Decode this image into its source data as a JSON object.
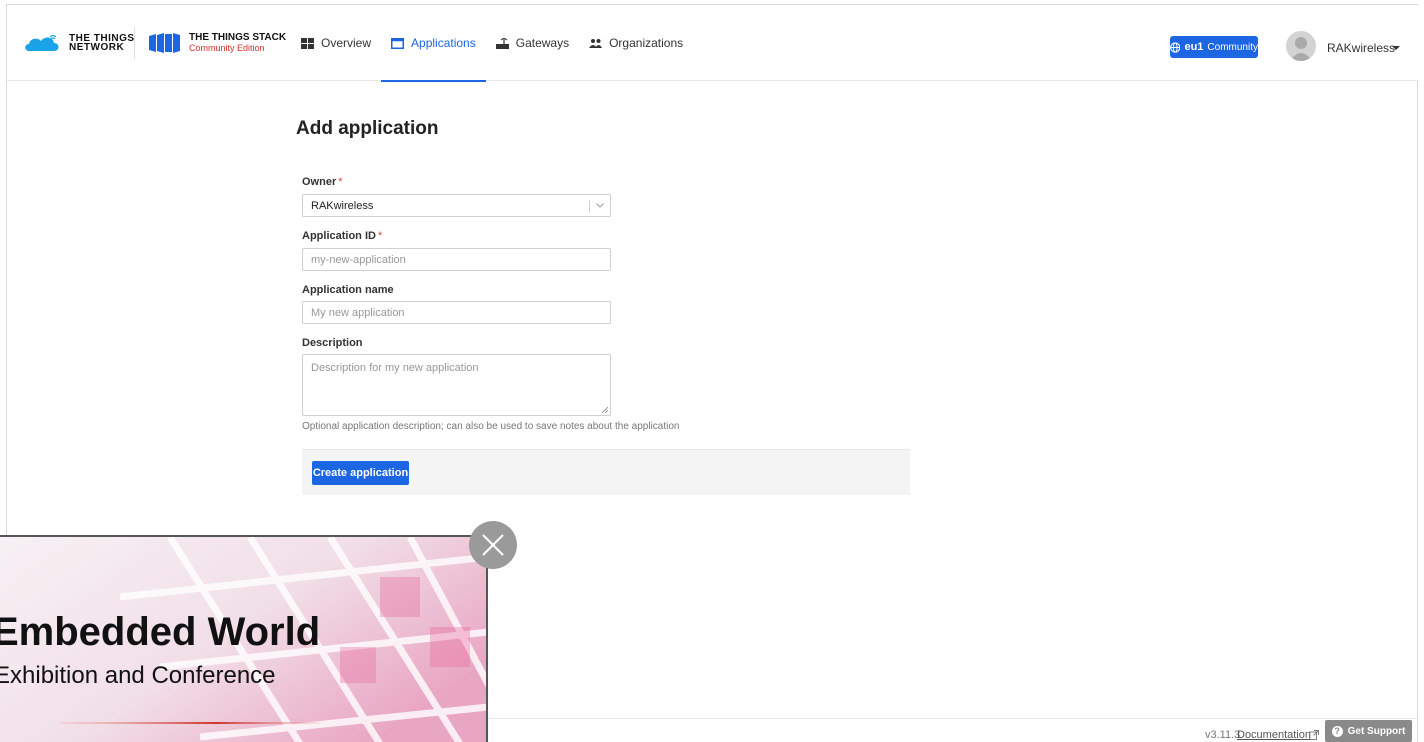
{
  "header": {
    "ttn_logo_line1": "THE THINGS",
    "ttn_logo_line2": "NETWORK",
    "tts_logo_title": "THE THINGS STACK",
    "tts_logo_subtitle": "Community Edition",
    "nav": [
      {
        "label": "Overview",
        "icon": "overview-icon",
        "active": false
      },
      {
        "label": "Applications",
        "icon": "applications-icon",
        "active": true
      },
      {
        "label": "Gateways",
        "icon": "gateway-icon",
        "active": false
      },
      {
        "label": "Organizations",
        "icon": "organizations-icon",
        "active": false
      }
    ],
    "cluster_region": "eu1",
    "cluster_label": "Community",
    "user_name": "RAKwireless"
  },
  "form": {
    "title": "Add application",
    "owner_label": "Owner",
    "owner_value": "RAKwireless",
    "app_id_label": "Application ID",
    "app_id_placeholder": "my-new-application",
    "app_name_label": "Application name",
    "app_name_placeholder": "My new application",
    "description_label": "Description",
    "description_placeholder": "Description for my new application",
    "description_hint": "Optional application description; can also be used to save notes about the application",
    "submit_label": "Create application",
    "required_mark": "*"
  },
  "footer": {
    "version": "v3.11.3",
    "documentation": "Documentation",
    "support": "Get Support"
  },
  "promo": {
    "title": "Embedded World",
    "subtitle": "Exhibition and Conference"
  },
  "colors": {
    "accent": "#1c65e3",
    "required": "#e23b3b",
    "brand_red": "#d0342c"
  }
}
